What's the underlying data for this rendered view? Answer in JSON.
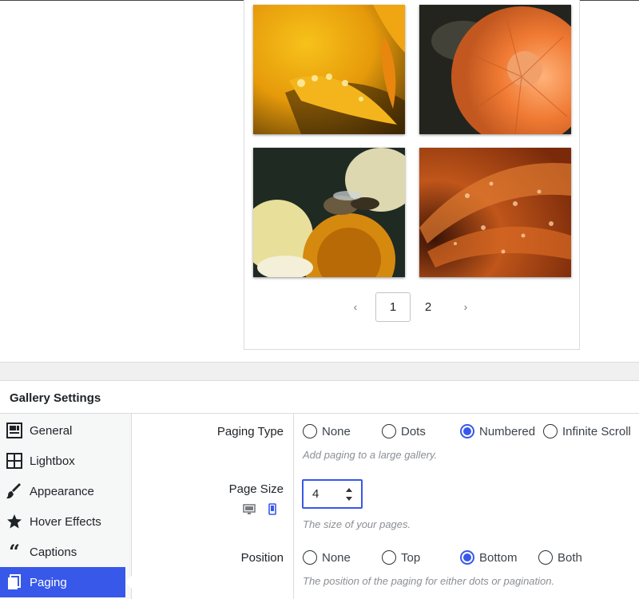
{
  "preview": {
    "images": [
      {
        "name": "yellow-flower-dewdrops"
      },
      {
        "name": "orange-dahlia"
      },
      {
        "name": "bee-on-coneflower"
      },
      {
        "name": "orange-petals-water-drops"
      }
    ],
    "pagination": {
      "prev_symbol": "‹",
      "pages": [
        "1",
        "2"
      ],
      "current_page": "1",
      "next_symbol": "›"
    }
  },
  "panel": {
    "title": "Gallery Settings",
    "nav_items": [
      {
        "label": "General",
        "icon": "gallery-icon"
      },
      {
        "label": "Lightbox",
        "icon": "grid-icon"
      },
      {
        "label": "Appearance",
        "icon": "brush-icon"
      },
      {
        "label": "Hover Effects",
        "icon": "star-icon"
      },
      {
        "label": "Captions",
        "icon": "quote-icon"
      },
      {
        "label": "Paging",
        "icon": "pages-icon",
        "active": true
      }
    ],
    "accent_color": "#3858e9"
  },
  "settings": {
    "paging_type": {
      "label": "Paging Type",
      "options": [
        "None",
        "Dots",
        "Numbered",
        "Infinite Scroll"
      ],
      "selected": "Numbered",
      "help": "Add paging to a large gallery."
    },
    "page_size": {
      "label": "Page Size",
      "value": "4",
      "help": "The size of your pages.",
      "devices": [
        "desktop-icon",
        "mobile-icon"
      ],
      "active_device": "mobile-icon"
    },
    "position": {
      "label": "Position",
      "options": [
        "None",
        "Top",
        "Bottom",
        "Both"
      ],
      "selected": "Bottom",
      "help": "The position of the paging for either dots or pagination."
    }
  }
}
